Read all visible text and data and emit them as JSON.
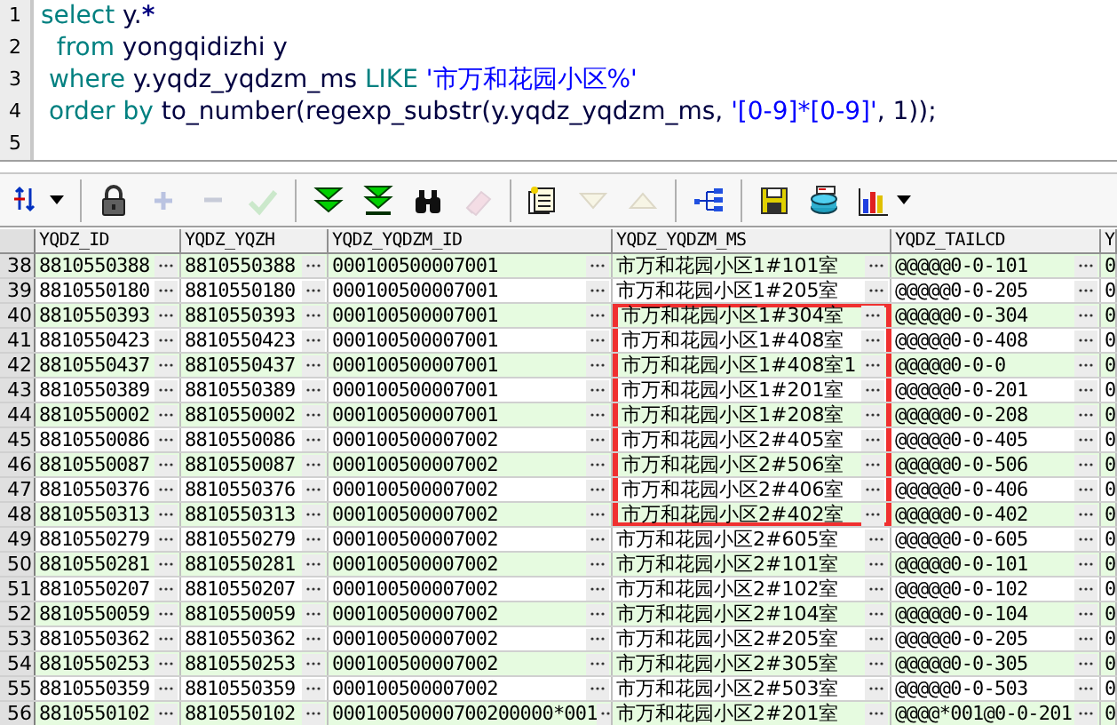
{
  "editor": {
    "lines": [
      {
        "number": "1",
        "tokens": [
          {
            "kind": "keyword",
            "text": "select"
          },
          {
            "kind": "ident",
            "text": " y."
          },
          {
            "kind": "op",
            "text": "*"
          }
        ]
      },
      {
        "number": "2",
        "tokens": [
          {
            "kind": "keyword",
            "text": "  from"
          },
          {
            "kind": "ident",
            "text": " yongqidizhi y"
          }
        ]
      },
      {
        "number": "3",
        "tokens": [
          {
            "kind": "keyword",
            "text": " where"
          },
          {
            "kind": "ident",
            "text": " y.yqdz_yqdzm_ms "
          },
          {
            "kind": "keyword",
            "text": "LIKE"
          },
          {
            "kind": "string",
            "text": " '市万和花园小区%'"
          }
        ]
      },
      {
        "number": "4",
        "tokens": [
          {
            "kind": "keyword",
            "text": " order by"
          },
          {
            "kind": "ident",
            "text": " to_number(regexp_substr(y.yqdz_yqdzm_ms, "
          },
          {
            "kind": "string",
            "text": "'[0-9]*[0-9]'"
          },
          {
            "kind": "ident",
            "text": ", 1));"
          }
        ]
      },
      {
        "number": "5"
      }
    ]
  },
  "toolbar": [
    {
      "kind": "sort",
      "disabled": false,
      "dropdown": true
    },
    {
      "kind": "separator"
    },
    {
      "kind": "lock",
      "disabled": false
    },
    {
      "kind": "add",
      "disabled": true
    },
    {
      "kind": "remove",
      "disabled": true
    },
    {
      "kind": "confirm",
      "disabled": true
    },
    {
      "kind": "separator"
    },
    {
      "kind": "next",
      "disabled": false
    },
    {
      "kind": "last",
      "disabled": false
    },
    {
      "kind": "find",
      "disabled": false
    },
    {
      "kind": "clear",
      "disabled": true
    },
    {
      "kind": "separator"
    },
    {
      "kind": "notes",
      "disabled": false
    },
    {
      "kind": "down",
      "disabled": true
    },
    {
      "kind": "up",
      "disabled": true
    },
    {
      "kind": "separator"
    },
    {
      "kind": "tree",
      "disabled": false
    },
    {
      "kind": "separator"
    },
    {
      "kind": "save",
      "disabled": false
    },
    {
      "kind": "database",
      "disabled": false
    },
    {
      "kind": "chart",
      "disabled": false,
      "dropdown": true
    }
  ],
  "table": {
    "columns": [
      "YQDZ_ID",
      "YQDZ_YQZH",
      "YQDZ_YQDZM_ID",
      "YQDZ_YQDZM_MS",
      "YQDZ_TAILCD",
      "Y"
    ],
    "rows": [
      {
        "number": "38",
        "boxed": false,
        "cells": [
          "8810550388",
          "8810550388",
          "000100500007001",
          "市万和花园小区1#101室",
          "@@@@@0-0-101",
          "0"
        ]
      },
      {
        "number": "39",
        "boxed": false,
        "cells": [
          "8810550180",
          "8810550180",
          "000100500007001",
          "市万和花园小区1#205室",
          "@@@@@0-0-205",
          "0"
        ]
      },
      {
        "number": "40",
        "boxed": true,
        "cells": [
          "8810550393",
          "8810550393",
          "000100500007001",
          "市万和花园小区1#304室",
          "@@@@@0-0-304",
          "0"
        ]
      },
      {
        "number": "41",
        "boxed": true,
        "cells": [
          "8810550423",
          "8810550423",
          "000100500007001",
          "市万和花园小区1#408室",
          "@@@@@0-0-408",
          "0"
        ]
      },
      {
        "number": "42",
        "boxed": true,
        "cells": [
          "8810550437",
          "8810550437",
          "000100500007001",
          "市万和花园小区1#408室1",
          "@@@@@0-0-0",
          "0"
        ]
      },
      {
        "number": "43",
        "boxed": true,
        "cells": [
          "8810550389",
          "8810550389",
          "000100500007001",
          "市万和花园小区1#201室",
          "@@@@@0-0-201",
          "0"
        ]
      },
      {
        "number": "44",
        "boxed": true,
        "cells": [
          "8810550002",
          "8810550002",
          "000100500007001",
          "市万和花园小区1#208室",
          "@@@@@0-0-208",
          "0"
        ]
      },
      {
        "number": "45",
        "boxed": true,
        "cells": [
          "8810550086",
          "8810550086",
          "000100500007002",
          "市万和花园小区2#405室",
          "@@@@@0-0-405",
          "0"
        ]
      },
      {
        "number": "46",
        "boxed": true,
        "cells": [
          "8810550087",
          "8810550087",
          "000100500007002",
          "市万和花园小区2#506室",
          "@@@@@0-0-506",
          "0"
        ]
      },
      {
        "number": "47",
        "boxed": true,
        "cells": [
          "8810550376",
          "8810550376",
          "000100500007002",
          "市万和花园小区2#406室",
          "@@@@@0-0-406",
          "0"
        ]
      },
      {
        "number": "48",
        "boxed": true,
        "cells": [
          "8810550313",
          "8810550313",
          "000100500007002",
          "市万和花园小区2#402室",
          "@@@@@0-0-402",
          "0"
        ]
      },
      {
        "number": "49",
        "boxed": false,
        "cells": [
          "8810550279",
          "8810550279",
          "000100500007002",
          "市万和花园小区2#605室",
          "@@@@@0-0-605",
          "0"
        ]
      },
      {
        "number": "50",
        "boxed": false,
        "cells": [
          "8810550281",
          "8810550281",
          "000100500007002",
          "市万和花园小区2#101室",
          "@@@@@0-0-101",
          "0"
        ]
      },
      {
        "number": "51",
        "boxed": false,
        "cells": [
          "8810550207",
          "8810550207",
          "000100500007002",
          "市万和花园小区2#102室",
          "@@@@@0-0-102",
          "0"
        ]
      },
      {
        "number": "52",
        "boxed": false,
        "cells": [
          "8810550059",
          "8810550059",
          "000100500007002",
          "市万和花园小区2#104室",
          "@@@@@0-0-104",
          "0"
        ]
      },
      {
        "number": "53",
        "boxed": false,
        "cells": [
          "8810550362",
          "8810550362",
          "000100500007002",
          "市万和花园小区2#205室",
          "@@@@@0-0-205",
          "0"
        ]
      },
      {
        "number": "54",
        "boxed": false,
        "cells": [
          "8810550253",
          "8810550253",
          "000100500007002",
          "市万和花园小区2#305室",
          "@@@@@0-0-305",
          "0"
        ]
      },
      {
        "number": "55",
        "boxed": false,
        "cells": [
          "8810550359",
          "8810550359",
          "000100500007002",
          "市万和花园小区2#503室",
          "@@@@@0-0-503",
          "0"
        ]
      },
      {
        "number": "56",
        "boxed": false,
        "cells": [
          "8810550102",
          "8810550102",
          "00010050000700200000*001",
          "市万和花园小区2#201室",
          "@@@@*001@0-0-201",
          "0"
        ]
      }
    ]
  }
}
